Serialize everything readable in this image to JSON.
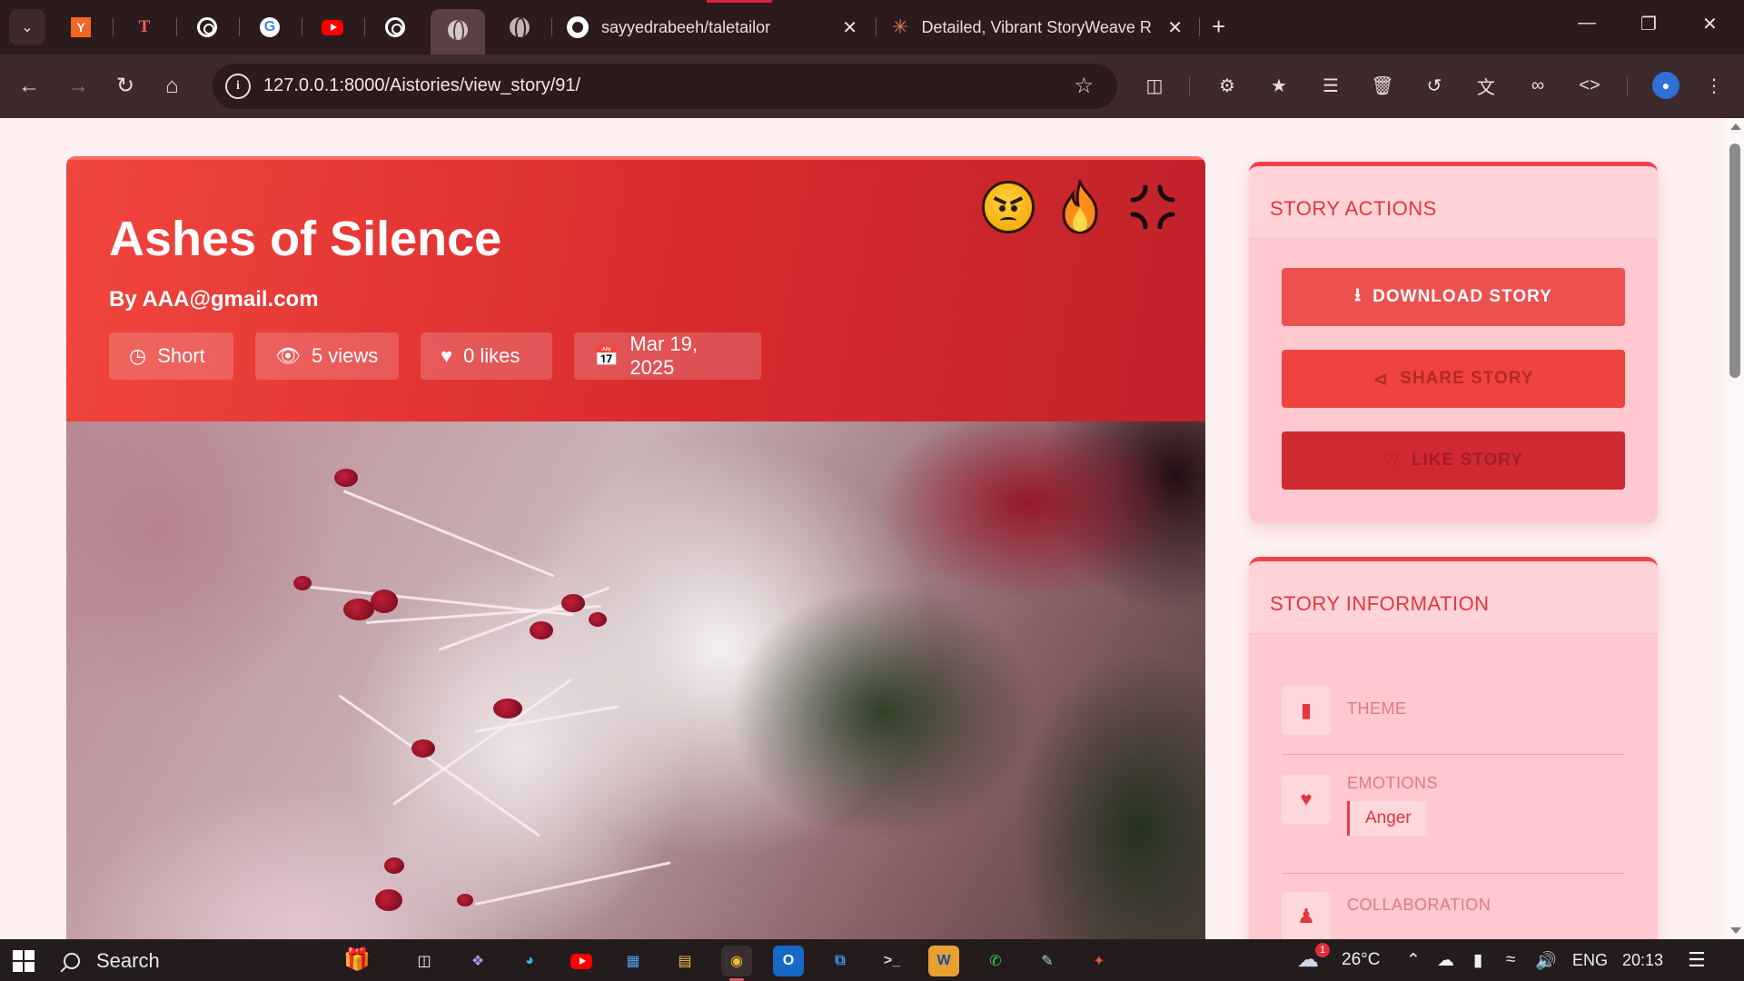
{
  "browser": {
    "pinned_tabs": [
      "Y",
      "T",
      "",
      "G",
      "",
      "",
      "",
      ""
    ],
    "tabs": [
      {
        "title": "sayyedrabeeh/taletailor"
      },
      {
        "title": "Detailed, Vibrant StoryWeave R"
      }
    ],
    "url": "127.0.0.1:8000/Aistories/view_story/91/"
  },
  "story": {
    "title": "Ashes of Silence",
    "author": "By AAA@gmail.com",
    "length": "Short",
    "views": "5 views",
    "likes": "0 likes",
    "date": "Mar 19, 2025",
    "emojis": [
      "angry-face",
      "fire",
      "anger-symbol"
    ]
  },
  "sidebar": {
    "actions": {
      "title": "STORY ACTIONS",
      "download": "DOWNLOAD STORY",
      "share": "SHARE STORY",
      "like": "LIKE STORY"
    },
    "info": {
      "title": "STORY INFORMATION",
      "theme_label": "THEME",
      "emotions_label": "EMOTIONS",
      "emotion_tag": "Anger",
      "collaboration_label": "COLLABORATION"
    }
  },
  "taskbar": {
    "search_placeholder": "Search",
    "weather_temp": "26°C",
    "weather_badge": "1",
    "language": "ENG",
    "time": "20:13"
  },
  "colors": {
    "header_red": "#d92b2f",
    "accent_red": "#e2373f",
    "sidebar_bg": "#ffc9cf",
    "page_bg": "#fff0f1"
  }
}
